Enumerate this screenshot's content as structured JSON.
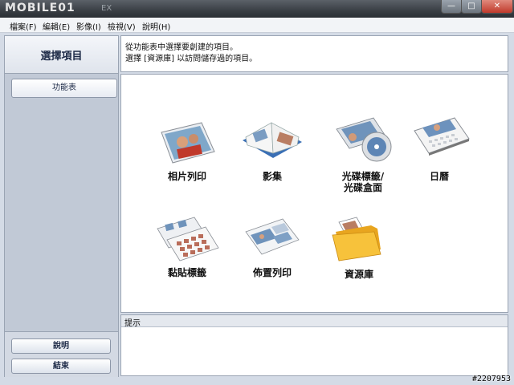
{
  "window": {
    "title_logo": "MOBILE01",
    "title_suffix": "EX",
    "buttons": {
      "minimize": "—",
      "maximize": "□",
      "close": "✕"
    }
  },
  "menu": [
    "檔案(F)",
    "編輯(E)",
    "影像(I)",
    "檢視(V)",
    "說明(H)"
  ],
  "sidebar": {
    "title": "選擇項目",
    "tab_label": "功能表",
    "help_button": "說明",
    "exit_button": "結束"
  },
  "info": {
    "line1": "從功能表中選擇要創建的項目。",
    "line2": "選擇 [資源庫] 以訪問儲存過的項目。"
  },
  "tiles": [
    {
      "label": "相片列印",
      "icon": "photo-print-icon"
    },
    {
      "label": "影集",
      "icon": "photo-album-icon"
    },
    {
      "label": "光碟標籤/\n光碟盒面",
      "line1": "光碟標籤/",
      "line2": "光碟盒面",
      "icon": "disc-label-icon"
    },
    {
      "label": "日曆",
      "icon": "calendar-icon"
    },
    {
      "label": "黏貼標籤",
      "icon": "sticker-icon"
    },
    {
      "label": "佈置列印",
      "icon": "layout-print-icon"
    },
    {
      "label": "資源庫",
      "icon": "library-folder-icon"
    }
  ],
  "hint": {
    "header": "提示"
  },
  "watermark": "#2207953",
  "colors": {
    "accent": "#1d2a47",
    "sidebar": "#c1c9d6",
    "panel_border": "#9aa4b3"
  }
}
